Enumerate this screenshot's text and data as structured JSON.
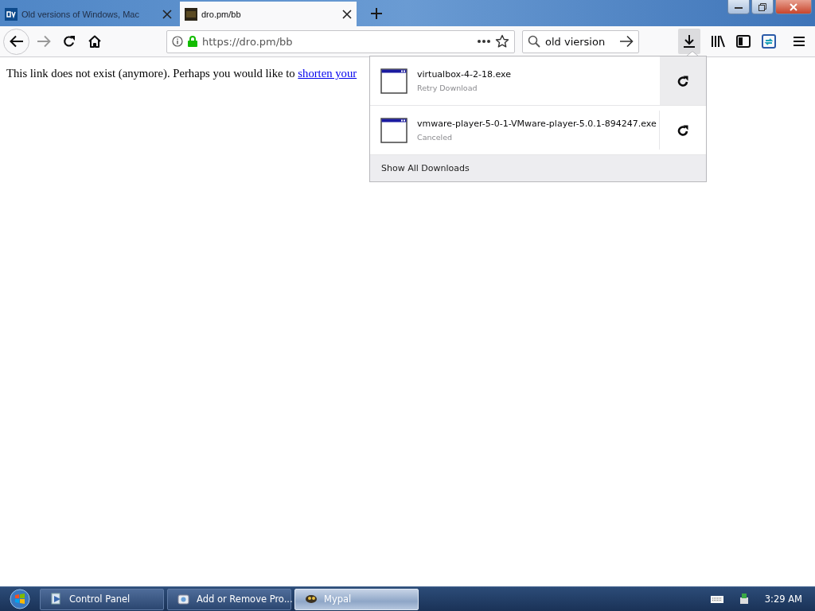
{
  "tabs": [
    {
      "title": "Old versions of Windows, Mac",
      "selected": false
    },
    {
      "title": "dro.pm/bb",
      "selected": true
    }
  ],
  "toolbar": {
    "url": "https://dro.pm/bb",
    "search": "old viersion",
    "downloads_open": true
  },
  "page": {
    "text": "This link does not exist (anymore). Perhaps you would like to ",
    "link": "shorten your"
  },
  "downloads": {
    "items": [
      {
        "name": "virtualbox-4-2-18.exe",
        "status": "Retry Download",
        "hovered": true
      },
      {
        "name": "vmware-player-5-0-1-VMware-player-5.0.1-894247.exe",
        "status": "Canceled",
        "hovered": false
      }
    ],
    "footer": "Show All Downloads"
  },
  "taskbar": {
    "items": [
      {
        "label": "Control Panel",
        "selected": false
      },
      {
        "label": "Add or Remove Pro...",
        "selected": false
      },
      {
        "label": "Mypal",
        "selected": true
      }
    ],
    "clock": "3:29 AM"
  }
}
